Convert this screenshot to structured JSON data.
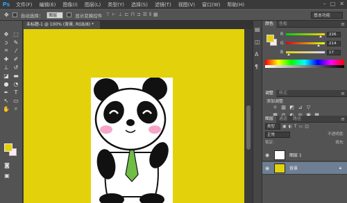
{
  "menubar": {
    "logo": "Ps",
    "items": [
      "文件(F)",
      "编辑(E)",
      "图像(I)",
      "图层(L)",
      "类型(Y)",
      "选择(S)",
      "滤镜(T)",
      "视图(V)",
      "窗口(W)",
      "帮助(H)"
    ]
  },
  "options": {
    "auto_select_label": "自动选择：",
    "auto_select_value": "图层",
    "transform_label": "显示变换控件",
    "workspace_value": "基本功能"
  },
  "document": {
    "tab_title": "未标题-1 @ 100% (背景, RGB/8) *"
  },
  "color_panel": {
    "tabs": [
      "颜色",
      "色板"
    ],
    "rows": [
      {
        "label": "R",
        "value": "226",
        "level": 0.886,
        "gradient": "linear-gradient(to right,#00d10b,#ffd10b)"
      },
      {
        "label": "G",
        "value": "214",
        "level": 0.839,
        "gradient": "linear-gradient(to right,#e2000b,#e2ff0b)"
      },
      {
        "label": "B",
        "value": "17",
        "level": 0.067,
        "gradient": "linear-gradient(to right,#e2d100,#e2d1ff)"
      }
    ]
  },
  "adjustments_panel": {
    "tabs": [
      "调整",
      "样式"
    ],
    "add_label": "添加调整",
    "row1": [
      "☼",
      "▥",
      "◩",
      "⊿",
      "▽"
    ],
    "row2": [
      "▦",
      "⚖",
      "◐",
      "◎",
      "▣",
      "▩"
    ],
    "row3": [
      "◧",
      "◨",
      "▱",
      "▤",
      "▧"
    ]
  },
  "layers_panel": {
    "tabs": [
      "图层",
      "通道",
      "路径"
    ],
    "kind_filter": "类型",
    "blend_mode": "正常",
    "opacity_label": "不透明度:",
    "lock_label": "锁定:",
    "fill_label": "填充:",
    "layers": [
      {
        "name": "图层 1",
        "thumb_color": "#ffffff",
        "selected": false
      },
      {
        "name": "背景",
        "thumb_color": "#e2d10b",
        "selected": true
      }
    ]
  }
}
